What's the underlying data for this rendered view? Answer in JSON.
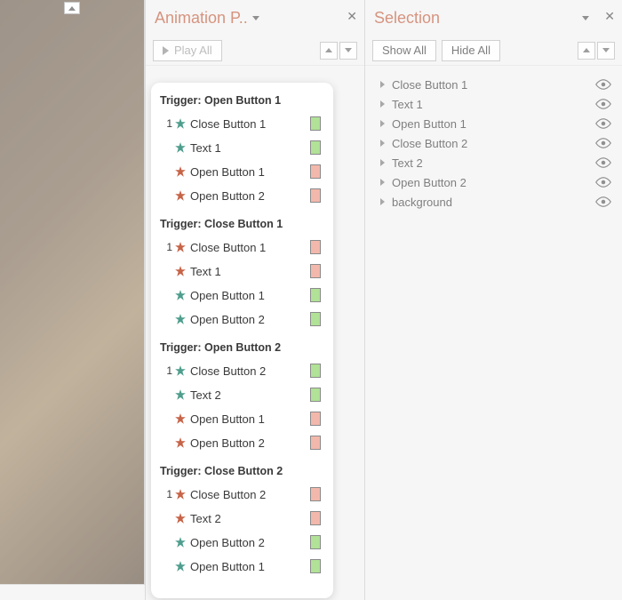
{
  "colors": {
    "accent": "#c05a3a",
    "green": "#b1e297",
    "red": "#f3b8ac"
  },
  "animationPane": {
    "title": "Animation P..",
    "playAll": "Play All",
    "groups": [
      {
        "title": "Trigger: Open Button 1",
        "items": [
          {
            "order": "1",
            "starColor": "green",
            "label": "Close Button 1",
            "swatch": "green"
          },
          {
            "order": "",
            "starColor": "green",
            "label": "Text 1",
            "swatch": "green"
          },
          {
            "order": "",
            "starColor": "red",
            "label": "Open Button 1",
            "swatch": "red"
          },
          {
            "order": "",
            "starColor": "red",
            "label": "Open Button 2",
            "swatch": "red"
          }
        ]
      },
      {
        "title": "Trigger: Close Button 1",
        "items": [
          {
            "order": "1",
            "starColor": "red",
            "label": "Close Button 1",
            "swatch": "red"
          },
          {
            "order": "",
            "starColor": "red",
            "label": "Text 1",
            "swatch": "red"
          },
          {
            "order": "",
            "starColor": "green",
            "label": "Open Button 1",
            "swatch": "green"
          },
          {
            "order": "",
            "starColor": "green",
            "label": "Open Button 2",
            "swatch": "green"
          }
        ]
      },
      {
        "title": "Trigger: Open Button 2",
        "items": [
          {
            "order": "1",
            "starColor": "green",
            "label": "Close Button 2",
            "swatch": "green"
          },
          {
            "order": "",
            "starColor": "green",
            "label": "Text 2",
            "swatch": "green"
          },
          {
            "order": "",
            "starColor": "red",
            "label": "Open Button 1",
            "swatch": "red"
          },
          {
            "order": "",
            "starColor": "red",
            "label": "Open Button 2",
            "swatch": "red"
          }
        ]
      },
      {
        "title": "Trigger: Close Button 2",
        "items": [
          {
            "order": "1",
            "starColor": "red",
            "label": "Close Button 2",
            "swatch": "red"
          },
          {
            "order": "",
            "starColor": "red",
            "label": "Text 2",
            "swatch": "red"
          },
          {
            "order": "",
            "starColor": "green",
            "label": "Open Button 2",
            "swatch": "green"
          },
          {
            "order": "",
            "starColor": "green",
            "label": "Open Button 1",
            "swatch": "green"
          }
        ]
      }
    ]
  },
  "selectionPane": {
    "title": "Selection",
    "showAll": "Show All",
    "hideAll": "Hide All",
    "items": [
      {
        "label": "Close Button 1"
      },
      {
        "label": "Text 1"
      },
      {
        "label": "Open Button 1"
      },
      {
        "label": "Close Button 2"
      },
      {
        "label": "Text 2"
      },
      {
        "label": "Open Button 2"
      },
      {
        "label": "background"
      }
    ]
  }
}
